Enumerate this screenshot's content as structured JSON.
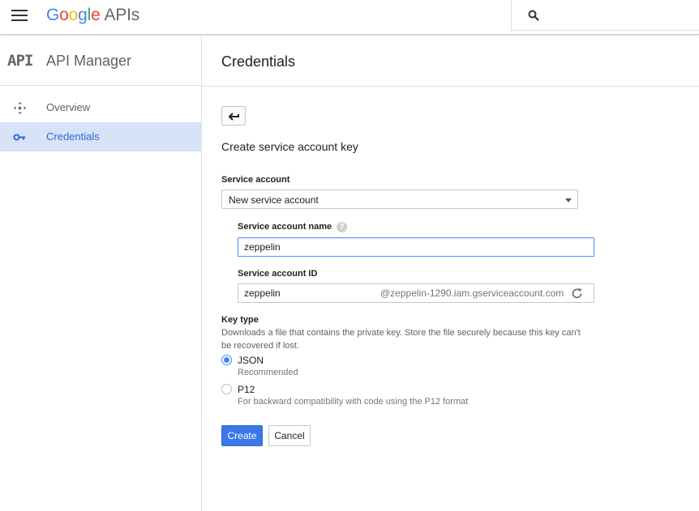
{
  "header": {
    "logo_letters": [
      "G",
      "o",
      "o",
      "g",
      "l",
      "e"
    ],
    "logo_suffix": "APIs",
    "search_placeholder": "",
    "icons": {
      "menu": "hamburger-menu-icon",
      "search": "search-icon"
    }
  },
  "sidebar": {
    "badge": "API",
    "title": "API Manager",
    "items": [
      {
        "label": "Overview",
        "icon": "overview-icon",
        "active": false
      },
      {
        "label": "Credentials",
        "icon": "key-icon",
        "active": true
      }
    ]
  },
  "main": {
    "title": "Credentials",
    "back_icon": "back-arrow-icon",
    "section_title": "Create service account key",
    "service_account": {
      "label": "Service account",
      "selected": "New service account"
    },
    "service_account_name": {
      "label": "Service account name",
      "value": "zeppelin"
    },
    "service_account_id": {
      "label": "Service account ID",
      "value": "zeppelin",
      "suffix": "@zeppelin-1290.iam.gserviceaccount.com"
    },
    "key_type": {
      "label": "Key type",
      "description": "Downloads a file that contains the private key. Store the file securely because this key can't be recovered if lost.",
      "options": [
        {
          "label": "JSON",
          "sub": "Recommended",
          "checked": true
        },
        {
          "label": "P12",
          "sub": "For backward compatibility with code using the P12 format",
          "checked": false
        }
      ]
    },
    "buttons": {
      "create": "Create",
      "cancel": "Cancel"
    }
  },
  "colors": {
    "accent": "#4285f4",
    "primary_button": "#3b78e7",
    "active_nav_bg": "#d7e3f6",
    "active_nav_text": "#3367d6"
  }
}
